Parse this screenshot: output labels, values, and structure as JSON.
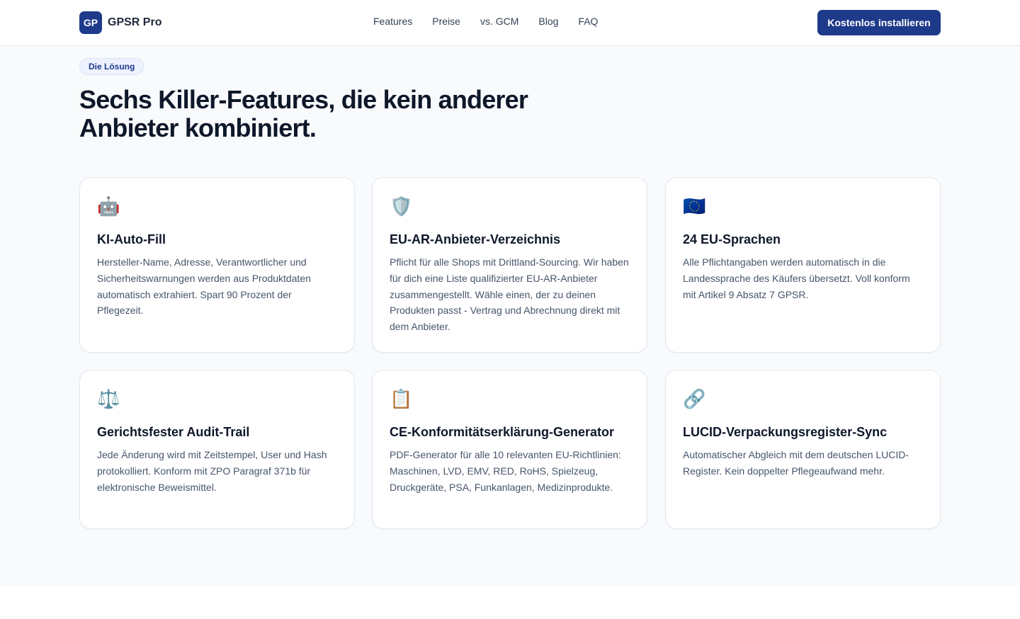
{
  "brand": {
    "logo": "GP",
    "name": "GPSR Pro"
  },
  "nav": {
    "links": [
      "Features",
      "Preise",
      "vs. GCM",
      "Blog",
      "FAQ"
    ]
  },
  "cta": {
    "label": "Kostenlos installieren"
  },
  "section": {
    "eyebrow": "Die Lösung",
    "headline": "Sechs Killer-Features, die kein anderer Anbieter kombiniert."
  },
  "features": [
    {
      "icon": "🤖",
      "icon_name": "robot-icon",
      "title": "KI-Auto-Fill",
      "body": "Hersteller-Name, Adresse, Verantwortlicher und Sicherheitswarnungen werden aus Produktdaten automatisch extrahiert. Spart 90 Prozent der Pflegezeit."
    },
    {
      "icon": "🛡️",
      "icon_name": "shield-icon",
      "title": "EU-AR-Anbieter-Verzeichnis",
      "body": "Pflicht für alle Shops mit Drittland-Sourcing. Wir haben für dich eine Liste qualifizierter EU-AR-Anbieter zusammengestellt. Wähle einen, der zu deinen Produkten passt - Vertrag und Abrechnung direkt mit dem Anbieter."
    },
    {
      "icon": "🇪🇺",
      "icon_name": "eu-flag-icon",
      "title": "24 EU-Sprachen",
      "body": "Alle Pflichtangaben werden automatisch in die Landessprache des Käufers übersetzt. Voll konform mit Artikel 9 Absatz 7 GPSR."
    },
    {
      "icon": "⚖️",
      "icon_name": "scales-icon",
      "title": "Gerichtsfester Audit-Trail",
      "body": "Jede Änderung wird mit Zeitstempel, User und Hash protokolliert. Konform mit ZPO Paragraf 371b für elektronische Beweismittel."
    },
    {
      "icon": "📋",
      "icon_name": "clipboard-icon",
      "title": "CE-Konformitätserklärung-Generator",
      "body": "PDF-Generator für alle 10 relevanten EU-Richtlinien: Maschinen, LVD, EMV, RED, RoHS, Spielzeug, Druckgeräte, PSA, Funkanlagen, Medizinprodukte."
    },
    {
      "icon": "🔗",
      "icon_name": "link-icon",
      "title": "LUCID-Verpackungsregister-Sync",
      "body": "Automatischer Abgleich mit dem deutschen LUCID-Register. Kein doppelter Pflegeaufwand mehr."
    }
  ],
  "colors": {
    "brand": "#1e3a8a",
    "background": "#f8fafc",
    "text": "#0f172a",
    "muted": "#475569"
  }
}
